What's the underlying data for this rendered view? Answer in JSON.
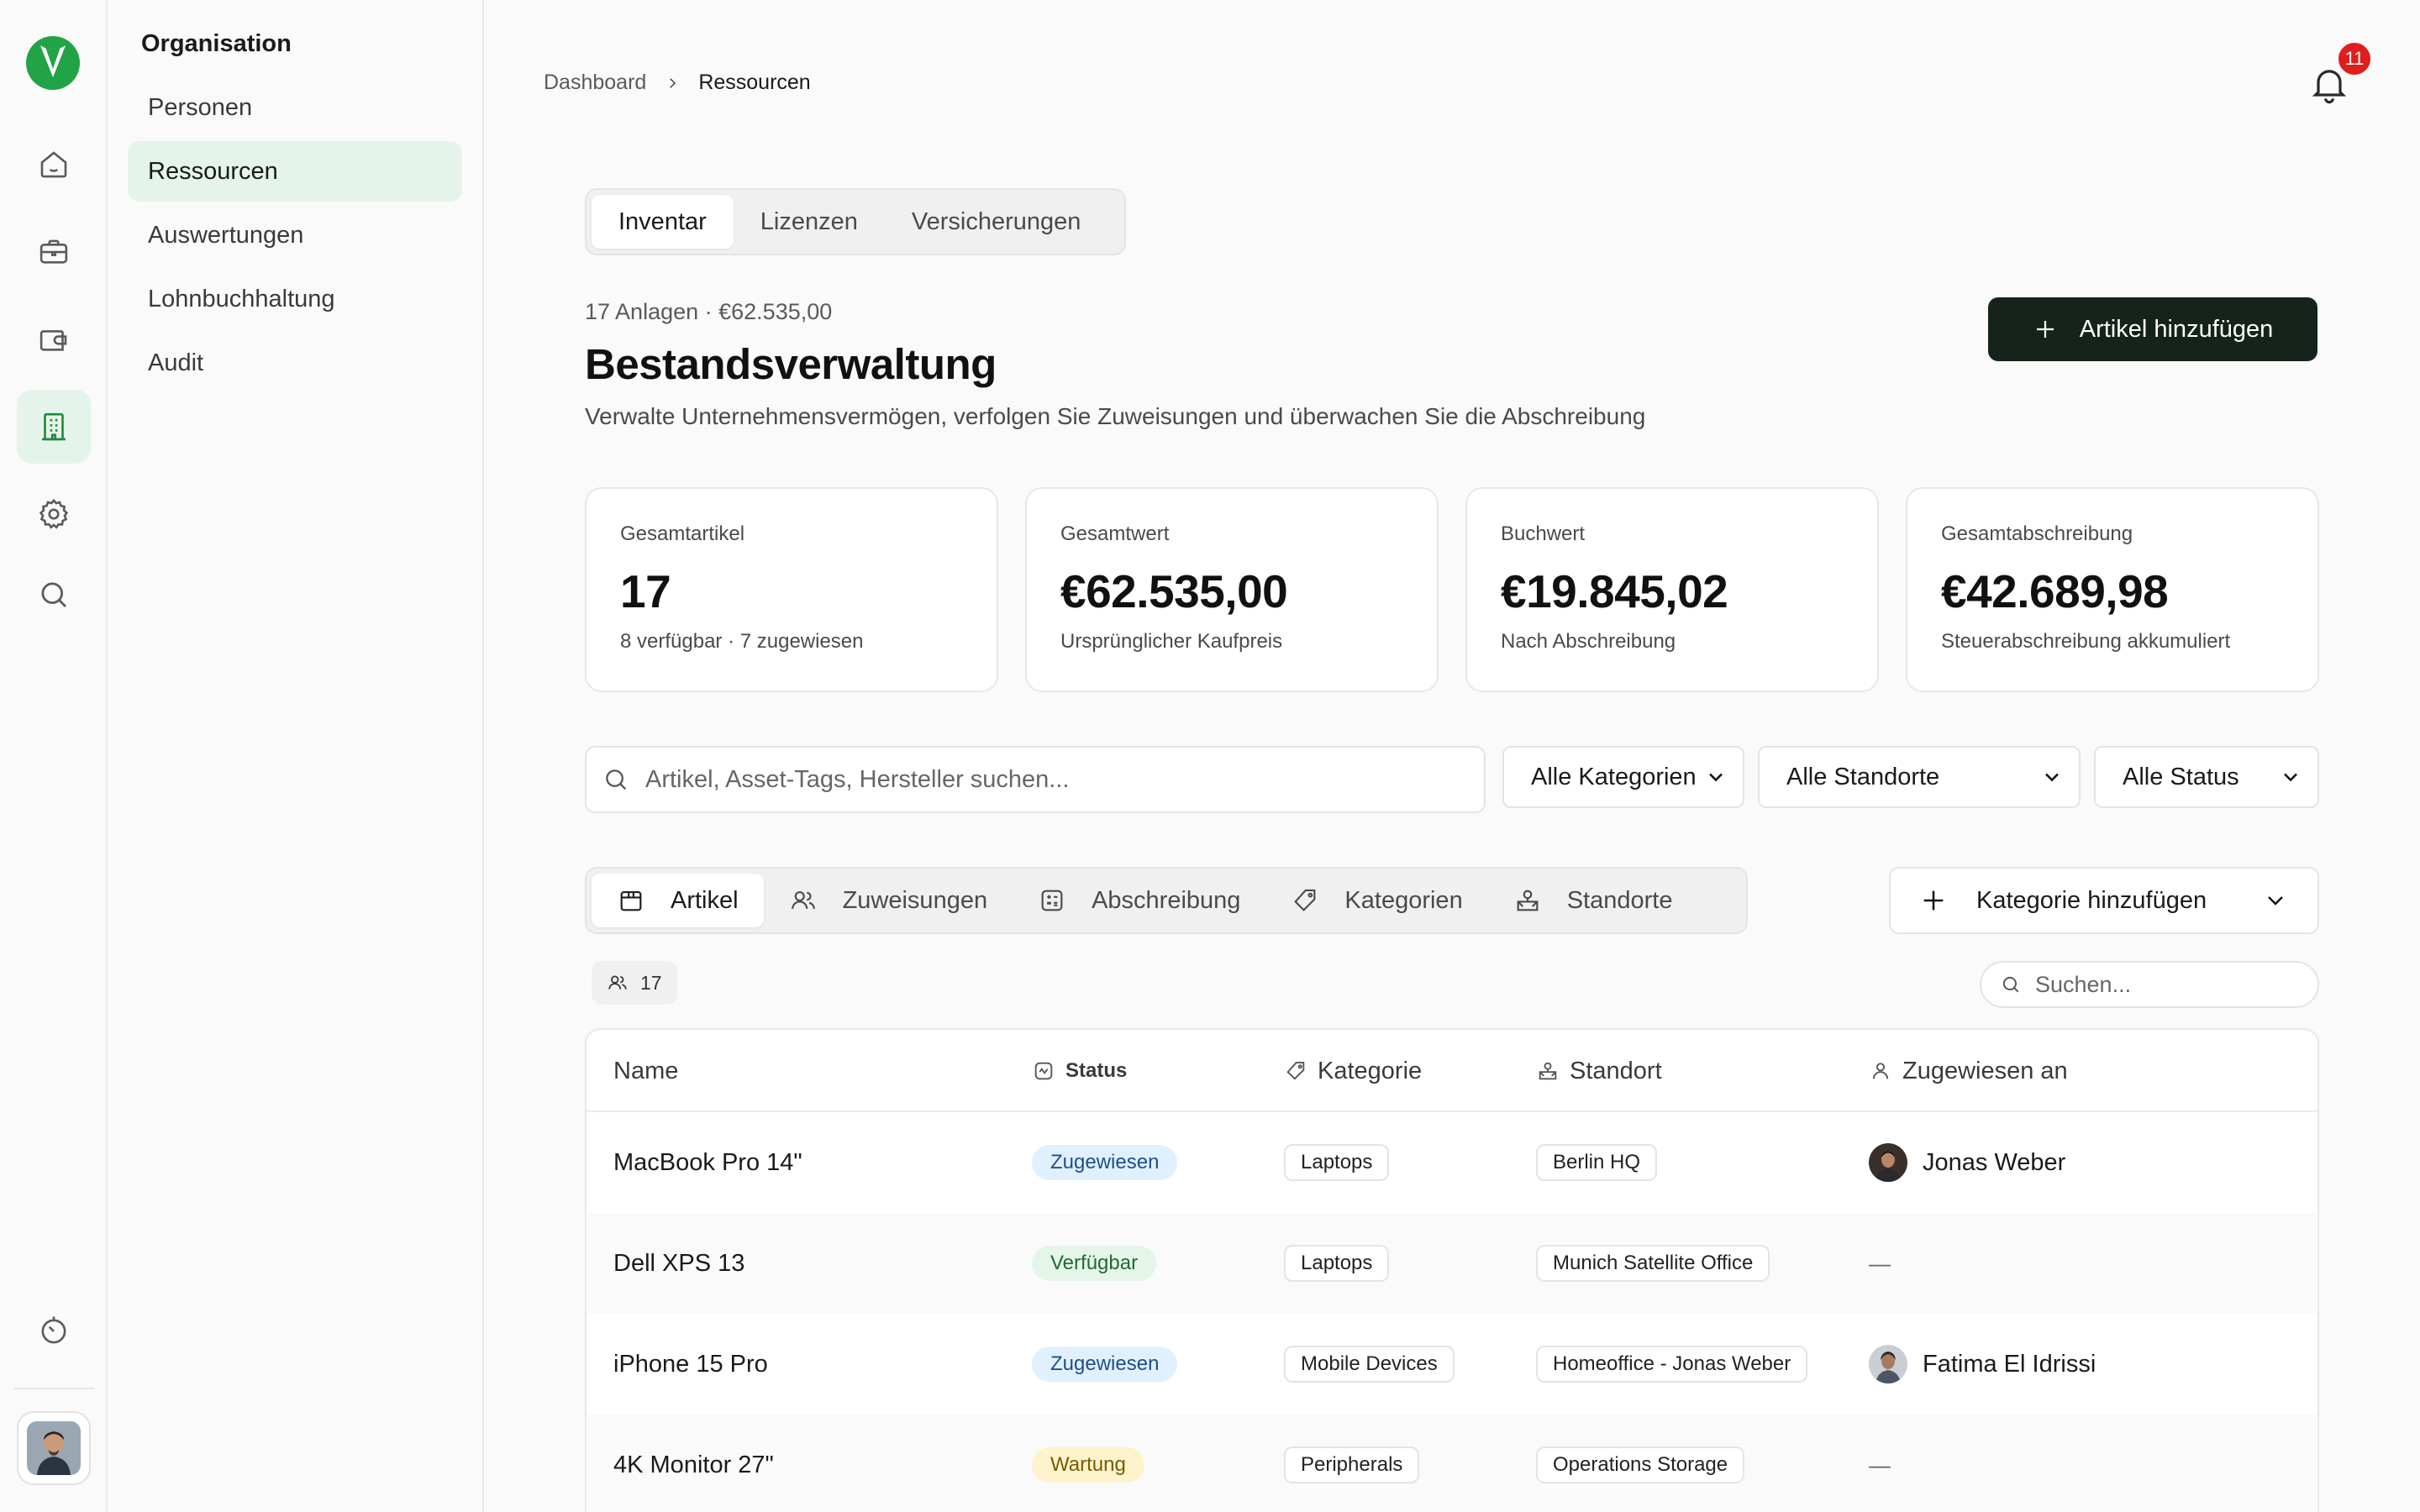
{
  "rail": {
    "icons": [
      "home-icon",
      "briefcase-icon",
      "wallet-icon",
      "building-icon",
      "gear-icon",
      "search-icon",
      "timer-icon"
    ],
    "active": "building-icon",
    "accent": "#1f8a3b"
  },
  "subnav": {
    "title": "Organisation",
    "items": [
      {
        "label": "Personen"
      },
      {
        "label": "Ressourcen"
      },
      {
        "label": "Auswertungen"
      },
      {
        "label": "Lohnbuchhaltung"
      },
      {
        "label": "Audit"
      }
    ],
    "active": "Ressourcen"
  },
  "breadcrumb": {
    "root": "Dashboard",
    "current": "Ressourcen"
  },
  "notifications": {
    "count": "11"
  },
  "top_tabs": [
    "Inventar",
    "Lizenzen",
    "Versicherungen"
  ],
  "header": {
    "meta": "17 Anlagen · €62.535,00",
    "title": "Bestandsverwaltung",
    "description": "Verwalte Unternehmensvermögen, verfolgen Sie Zuweisungen und überwachen Sie die Abschreibung",
    "add_button": "Artikel hinzufügen"
  },
  "stats": [
    {
      "label": "Gesamtartikel",
      "value": "17",
      "sub": "8 verfügbar · 7 zugewiesen"
    },
    {
      "label": "Gesamtwert",
      "value": "€62.535,00",
      "sub": "Ursprünglicher Kaufpreis"
    },
    {
      "label": "Buchwert",
      "value": "€19.845,02",
      "sub": "Nach Abschreibung"
    },
    {
      "label": "Gesamtabschreibung",
      "value": "€42.689,98",
      "sub": "Steuerabschreibung akkumuliert"
    }
  ],
  "filters": {
    "search_placeholder": "Artikel, Asset-Tags, Hersteller suchen...",
    "category": "Alle Kategorien",
    "location": "Alle Standorte",
    "status": "Alle Status"
  },
  "view_tabs": [
    {
      "label": "Artikel",
      "icon": "box-icon"
    },
    {
      "label": "Zuweisungen",
      "icon": "users-icon"
    },
    {
      "label": "Abschreibung",
      "icon": "calculator-icon"
    },
    {
      "label": "Kategorien",
      "icon": "tag-icon"
    },
    {
      "label": "Standorte",
      "icon": "location-icon"
    }
  ],
  "add_category_button": "Kategorie hinzufügen",
  "list": {
    "count": "17",
    "search_placeholder": "Suchen..."
  },
  "table": {
    "columns": [
      "Name",
      "Status",
      "Kategorie",
      "Standort",
      "Zugewiesen an"
    ],
    "rows": [
      {
        "name": "MacBook Pro 14\"",
        "status": "Zugewiesen",
        "status_kind": "assigned",
        "category": "Laptops",
        "location": "Berlin HQ",
        "assignee": "Jonas Weber"
      },
      {
        "name": "Dell XPS 13",
        "status": "Verfügbar",
        "status_kind": "available",
        "category": "Laptops",
        "location": "Munich Satellite Office",
        "assignee": "—"
      },
      {
        "name": "iPhone 15 Pro",
        "status": "Zugewiesen",
        "status_kind": "assigned",
        "category": "Mobile Devices",
        "location": "Homeoffice - Jonas Weber",
        "assignee": "Fatima El Idrissi"
      },
      {
        "name": "4K Monitor 27\"",
        "status": "Wartung",
        "status_kind": "maintenance",
        "category": "Peripherals",
        "location": "Operations Storage",
        "assignee": "—"
      }
    ]
  }
}
